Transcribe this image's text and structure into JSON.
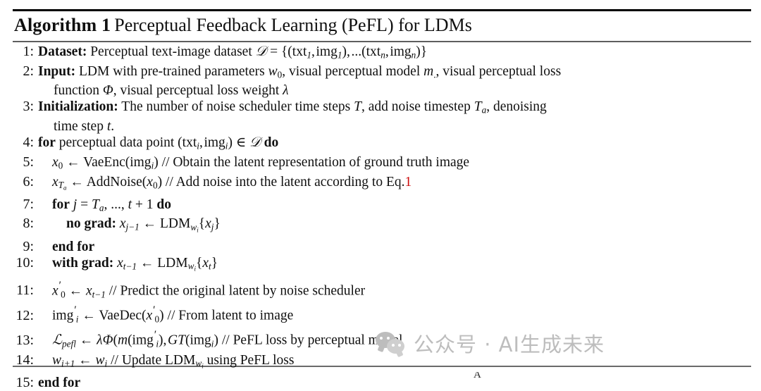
{
  "document": {
    "type": "algorithm-block",
    "title_number": "Algorithm 1",
    "title_caption": "Perceptual Feedback Learning (PeFL) for LDMs",
    "accent_citation_color": "#cc0c0c"
  },
  "lines": [
    {
      "n": "1:",
      "indent": 0,
      "keyword": "Dataset:",
      "text": "Perceptual text-image dataset D = {(txt1, img1), ...(txtn, imgn)}"
    },
    {
      "n": "2:",
      "indent": 0,
      "keyword": "Input:",
      "text": "LDM with pre-trained parameters w0, visual perceptual model m., visual perceptual loss",
      "continuation": "function Φ, visual perceptual loss weight λ"
    },
    {
      "n": "3:",
      "indent": 0,
      "keyword": "Initialization:",
      "text": "The number of noise scheduler time steps T, add noise timestep Ta, denoising",
      "continuation": "time step t."
    },
    {
      "n": "4:",
      "indent": 0,
      "keyword": "for",
      "text": "perceptual data point (txti, imgi) ∈ D do"
    },
    {
      "n": "5:",
      "indent": 1,
      "text": "x0 ← VaeEnc(imgi) // Obtain the latent representation of ground truth image"
    },
    {
      "n": "6:",
      "indent": 1,
      "text": "xTa ← AddNoise(x0) // Add noise into the latent according to Eq.1",
      "citation": "1"
    },
    {
      "n": "7:",
      "indent": 1,
      "keyword": "for",
      "text": "j = Ta, ..., t + 1 do"
    },
    {
      "n": "8:",
      "indent": 2,
      "keyword": "no grad:",
      "text": "xj−1 ← LDMwi{xj}"
    },
    {
      "n": "9:",
      "indent": 1,
      "keyword": "end for",
      "text": ""
    },
    {
      "n": "10:",
      "indent": 1,
      "keyword": "with grad:",
      "text": "xt−1 ← LDMwi{xt}"
    },
    {
      "n": "11:",
      "indent": 1,
      "text": "x′0 ← xt−1 // Predict the original latent by noise scheduler"
    },
    {
      "n": "12:",
      "indent": 1,
      "text": "img′i ← VaeDec(x′0) // From latent to image"
    },
    {
      "n": "13:",
      "indent": 1,
      "text": "Lpefl ← λΦ(m(img′i), GT(imgi)) // PeFL loss by perceptual model"
    },
    {
      "n": "14:",
      "indent": 1,
      "text": "wi+1 ← wi // Update LDMwi using PeFL loss"
    },
    {
      "n": "15:",
      "indent": 0,
      "keyword": "end for",
      "text": ""
    }
  ],
  "watermark": {
    "icon": "wechat-icon",
    "text": "公众号 · AI生成未来",
    "color": "#bdbdbd"
  },
  "artifact": {
    "clipped_glyph": "A"
  }
}
